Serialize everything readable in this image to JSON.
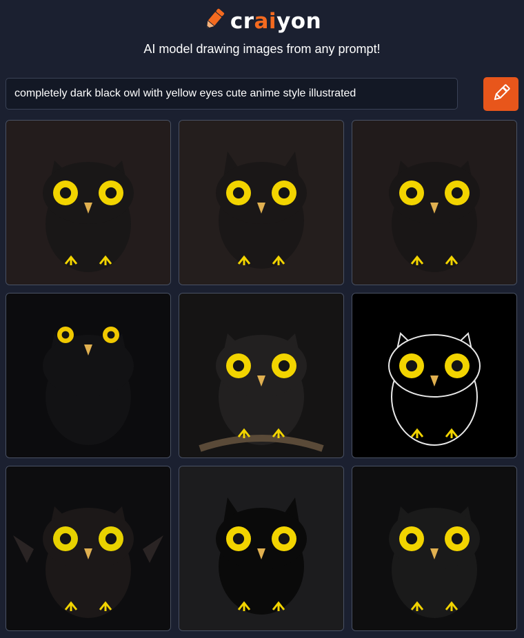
{
  "brand": {
    "logo_pre": "cr",
    "logo_accent": "ai",
    "logo_post": "yon",
    "accent_color": "#f46a1f"
  },
  "tagline": "AI model drawing images from any prompt!",
  "prompt": {
    "value": "completely dark black owl with yellow eyes cute anime style illustrated"
  },
  "draw_button": {
    "icon": "pencil-icon",
    "color": "#e8561b"
  },
  "results": [
    {
      "bg": "#231c1c",
      "body": "#191717",
      "eye": "#f2d400",
      "style": "round"
    },
    {
      "bg": "#241e1d",
      "body": "#1a1717",
      "eye": "#f2d400",
      "style": "tall"
    },
    {
      "bg": "#211b1b",
      "body": "#191616",
      "eye": "#f2d400",
      "style": "round"
    },
    {
      "bg": "#0c0c0e",
      "body": "#121214",
      "eye": "#f0c800",
      "style": "shadow"
    },
    {
      "bg": "#151414",
      "body": "#222020",
      "eye": "#f2d400",
      "style": "perched"
    },
    {
      "bg": "#000000",
      "body": "#000000",
      "eye": "#f2d400",
      "style": "outline"
    },
    {
      "bg": "#0d0d0f",
      "body": "#1c1818",
      "eye": "#e8d200",
      "style": "wings"
    },
    {
      "bg": "#1c1c1e",
      "body": "#0a0a0a",
      "eye": "#f2d400",
      "style": "tall"
    },
    {
      "bg": "#0e0e0f",
      "body": "#1a1a1a",
      "eye": "#f2d400",
      "style": "round"
    }
  ]
}
